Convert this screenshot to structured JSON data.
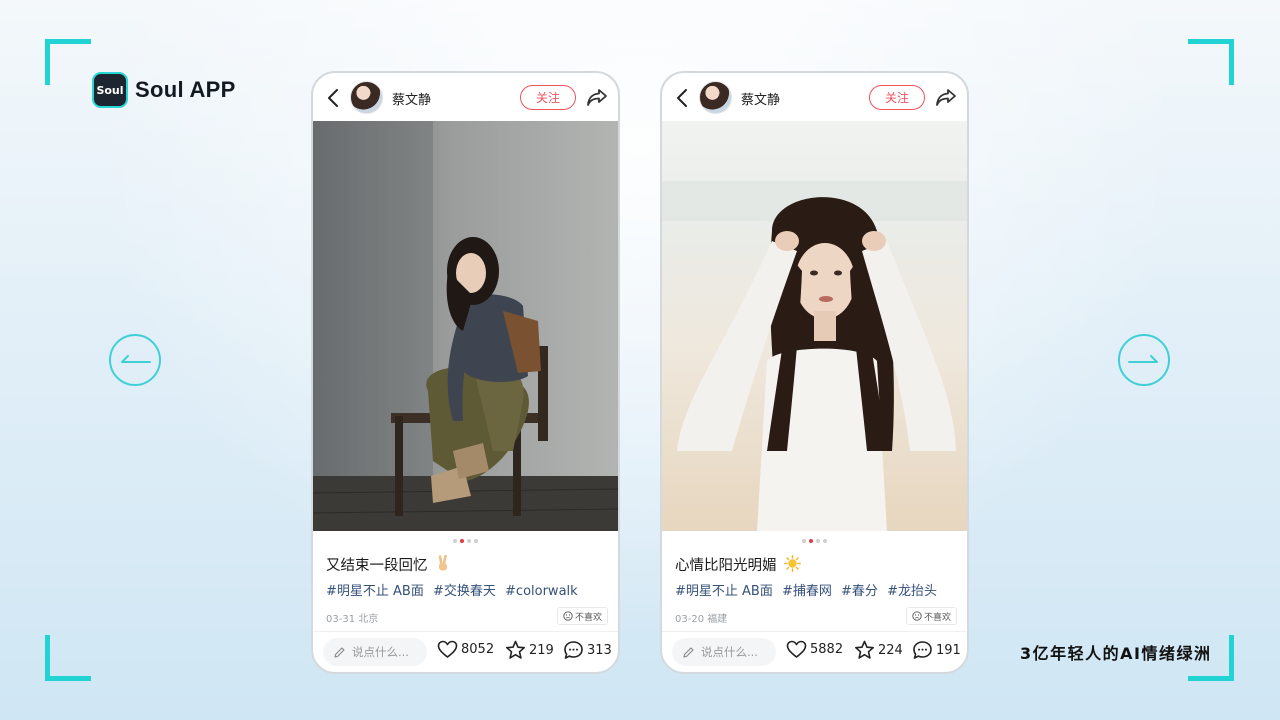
{
  "brand": {
    "logo_mark_text": "Soul",
    "name": "Soul APP",
    "slogan": "3亿年轻人的AI情绪绿洲",
    "accent_color": "#22d3d3"
  },
  "posts": [
    {
      "username": "蔡文静",
      "follow_label": "关注",
      "caption": "又结束一段回忆",
      "caption_emoji": "victory-hand-icon",
      "tags": [
        "#明星不止 AB面",
        "#交换春天",
        "#colorwalk"
      ],
      "date_location": "03-31 北京",
      "dislike_label": "不喜欢",
      "comment_placeholder": "说点什么...",
      "likes": "8052",
      "favorites": "219",
      "comments": "313",
      "image_index": 1,
      "image_count": 4
    },
    {
      "username": "蔡文静",
      "follow_label": "关注",
      "caption": "心情比阳光明媚",
      "caption_emoji": "sun-icon",
      "tags": [
        "#明星不止 AB面",
        "#捕春网",
        "#春分",
        "#龙抬头"
      ],
      "date_location": "03-20 福建",
      "dislike_label": "不喜欢",
      "comment_placeholder": "说点什么...",
      "likes": "5882",
      "favorites": "224",
      "comments": "191",
      "image_index": 1,
      "image_count": 4
    }
  ]
}
